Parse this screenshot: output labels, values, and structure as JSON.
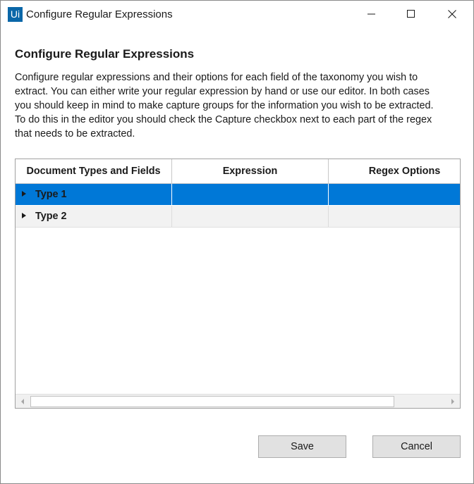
{
  "window": {
    "title": "Configure Regular Expressions",
    "app_logo_text": "Ui",
    "app_logo_color": "#0a67a8"
  },
  "header": {
    "heading": "Configure Regular Expressions",
    "description_lines": [
      "Configure regular expressions and their options for each field of the taxonomy you wish to",
      "extract. You can either write your regular expression by hand or use our editor. In both cases",
      "you should keep in mind to make capture groups for the information you wish to be extracted.",
      "To do this in the editor you should check the Capture checkbox next to each part of the regex",
      "that needs to be extracted."
    ]
  },
  "grid": {
    "columns": [
      "Document Types and Fields",
      "Expression",
      "Regex Options"
    ],
    "rows": [
      {
        "label": "Type 1",
        "expression": "",
        "regex_options": "",
        "selected": true
      },
      {
        "label": "Type 2",
        "expression": "",
        "regex_options": "",
        "selected": false
      }
    ],
    "selection_color": "#0078d7"
  },
  "buttons": {
    "save": "Save",
    "cancel": "Cancel"
  }
}
